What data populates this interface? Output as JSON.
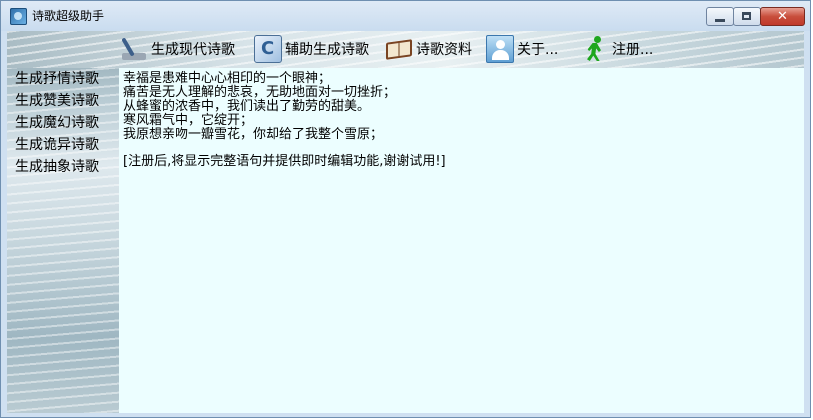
{
  "window": {
    "title": "诗歌超级助手"
  },
  "toolbar": [
    {
      "label": "生成现代诗歌",
      "icon": "pen-icon"
    },
    {
      "label": "辅助生成诗歌",
      "icon": "assist-icon"
    },
    {
      "label": "诗歌资料",
      "icon": "book-icon"
    },
    {
      "label": "关于...",
      "icon": "user-icon"
    },
    {
      "label": "注册...",
      "icon": "runner-icon"
    }
  ],
  "sidebar": {
    "items": [
      {
        "label": "生成抒情诗歌"
      },
      {
        "label": "生成赞美诗歌"
      },
      {
        "label": "生成魔幻诗歌"
      },
      {
        "label": "生成诡异诗歌"
      },
      {
        "label": "生成抽象诗歌"
      }
    ]
  },
  "content": {
    "poem_lines": [
      "幸福是患难中心心相印的一个眼神；",
      "痛苦是无人理解的悲哀，无助地面对一切挫折；",
      "从蜂蜜的浓香中，我们读出了勤劳的甜美。",
      "寒风霜气中，它绽开；",
      "我原想亲吻一瓣雪花，你却给了我整个雪原；"
    ],
    "notice": "[注册后,将显示完整语句并提供即时编辑功能,谢谢试用!]"
  }
}
